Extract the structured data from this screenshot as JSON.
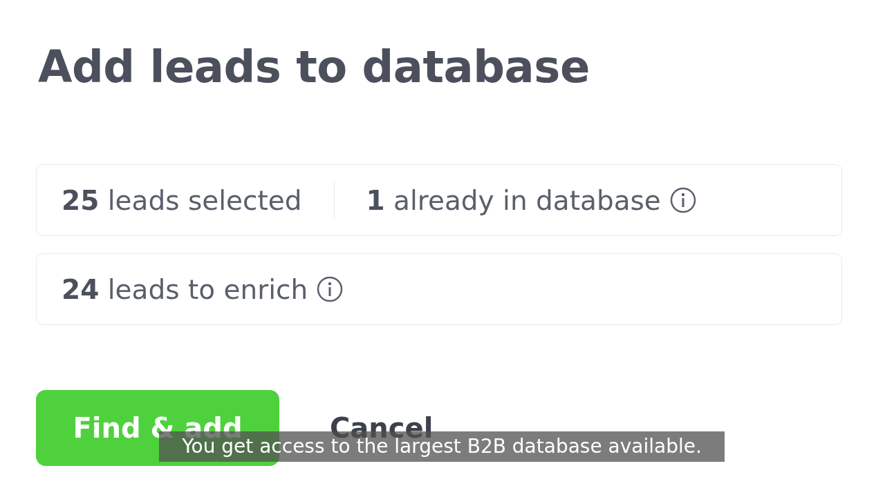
{
  "dialog": {
    "title": "Add leads to database",
    "cards": [
      {
        "items": [
          {
            "count": "25",
            "label": "leads selected",
            "info": false
          },
          {
            "count": "1",
            "label": "already in database",
            "info": true
          }
        ]
      },
      {
        "items": [
          {
            "count": "24",
            "label": "leads to enrich",
            "info": true
          }
        ]
      }
    ],
    "buttons": [
      {
        "label": "Find & add",
        "kind": "primary"
      },
      {
        "label": "Cancel",
        "kind": "secondary"
      }
    ]
  },
  "caption": "You get access to the largest B2B database available."
}
